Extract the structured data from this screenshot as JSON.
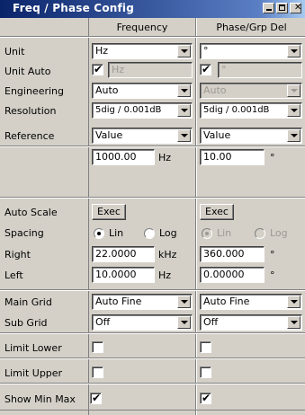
{
  "window": {
    "title": "Freq / Phase Config"
  },
  "columns": {
    "left": "Frequency",
    "right": "Phase/Grp Del"
  },
  "unit": {
    "label": "Unit",
    "freq": "Hz",
    "phase": "°"
  },
  "unit_auto": {
    "label": "Unit Auto",
    "freq_checked": true,
    "freq_value": "Hz",
    "phase_checked": true,
    "phase_value": "°"
  },
  "engineering": {
    "label": "Engineering",
    "freq": "Auto",
    "phase": "Auto"
  },
  "resolution": {
    "label": "Resolution",
    "freq": "5dig / 0.001dB",
    "phase": "5dig / 0.001dB"
  },
  "reference": {
    "label": "Reference",
    "freq_mode": "Value",
    "phase_mode": "Value",
    "freq_value": "1000.00",
    "freq_unit": "Hz",
    "phase_value": "10.00",
    "phase_unit": "°"
  },
  "auto_scale": {
    "label": "Auto Scale",
    "freq_button": "Exec",
    "phase_button": "Exec"
  },
  "spacing": {
    "label": "Spacing",
    "lin": "Lin",
    "log": "Log",
    "freq_selected": "Lin",
    "phase_selected": "Lin"
  },
  "right": {
    "label": "Right",
    "freq": "22.0000",
    "freq_unit": "kHz",
    "phase": "360.000",
    "phase_unit": "°"
  },
  "left": {
    "label": "Left",
    "freq": "10.0000",
    "freq_unit": "Hz",
    "phase": "0.00000",
    "phase_unit": "°"
  },
  "main_grid": {
    "label": "Main Grid",
    "freq": "Auto Fine",
    "phase": "Auto Fine"
  },
  "sub_grid": {
    "label": "Sub Grid",
    "freq": "Off",
    "phase": "Off"
  },
  "limit_lower": {
    "label": "Limit Lower",
    "freq_checked": false,
    "phase_checked": false
  },
  "limit_upper": {
    "label": "Limit Upper",
    "freq_checked": false,
    "phase_checked": false
  },
  "show_min_max": {
    "label": "Show Min Max",
    "freq_checked": true,
    "phase_checked": true
  },
  "glyphs": {
    "check": "✔",
    "close": "✕"
  }
}
